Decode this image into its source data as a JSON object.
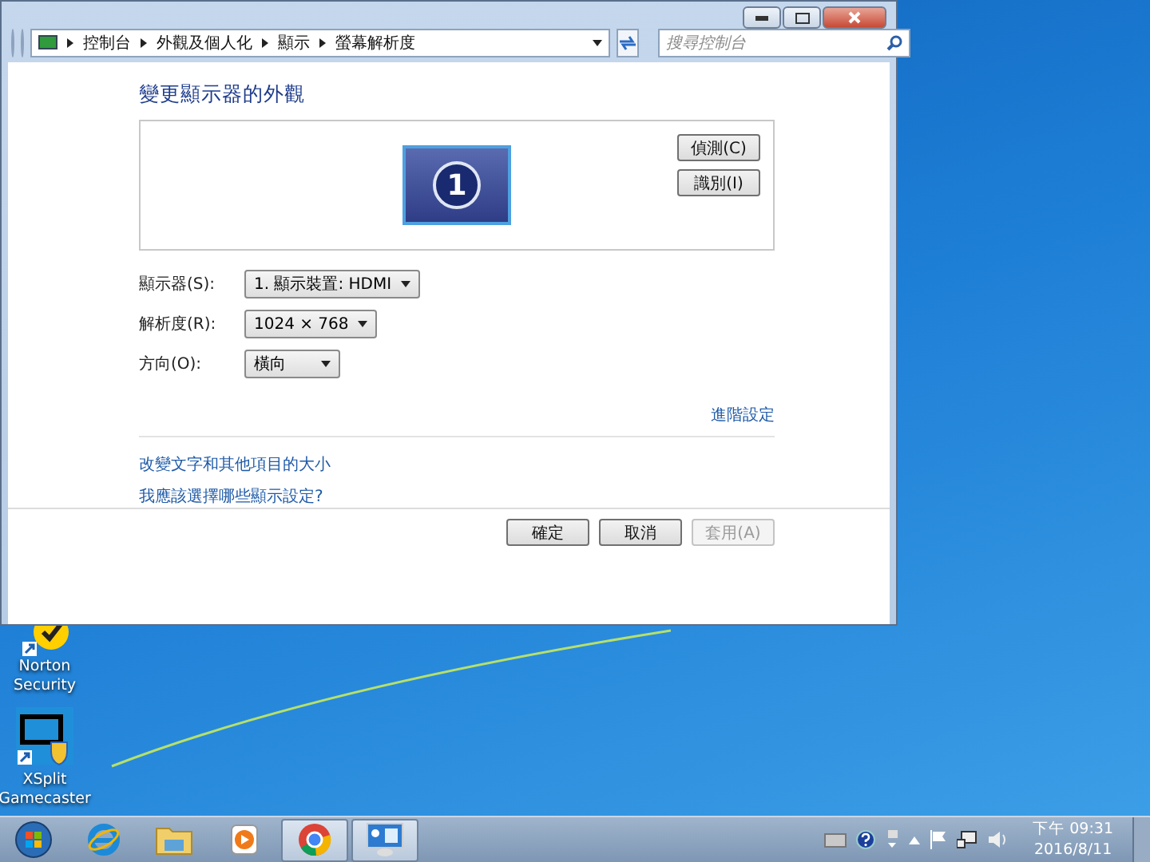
{
  "window": {
    "breadcrumb": [
      "控制台",
      "外觀及個人化",
      "顯示",
      "螢幕解析度"
    ],
    "search": {
      "placeholder": "搜尋控制台"
    },
    "heading": "變更顯示器的外觀",
    "monitor": {
      "number": "1"
    },
    "side_buttons": [
      "偵測(C)",
      "識別(I)"
    ],
    "settings": [
      {
        "label": "顯示器(S):",
        "value": "1. 顯示裝置: HDMI"
      },
      {
        "label": "解析度(R):",
        "value": "1024 × 768"
      },
      {
        "label": "方向(O):",
        "value": "橫向"
      }
    ],
    "advanced_link": "進階設定",
    "links": [
      "改變文字和其他項目的大小",
      "我應該選擇哪些顯示設定?"
    ],
    "buttons": [
      {
        "label": "確定",
        "disabled": false
      },
      {
        "label": "取消",
        "disabled": false
      },
      {
        "label": "套用(A)",
        "disabled": true
      }
    ]
  },
  "desktop_icons": [
    {
      "label": "Norton Security",
      "kind": "norton"
    },
    {
      "label": "XSplit Gamecaster",
      "kind": "xsplit"
    }
  ],
  "taskbar": {
    "items": [
      {
        "kind": "ie",
        "active": false
      },
      {
        "kind": "folder",
        "active": false
      },
      {
        "kind": "media",
        "active": false
      },
      {
        "kind": "chrome",
        "active": true
      },
      {
        "kind": "display",
        "active": true
      }
    ],
    "clock": {
      "time": "下午 09:31",
      "date": "2016/8/11"
    }
  }
}
